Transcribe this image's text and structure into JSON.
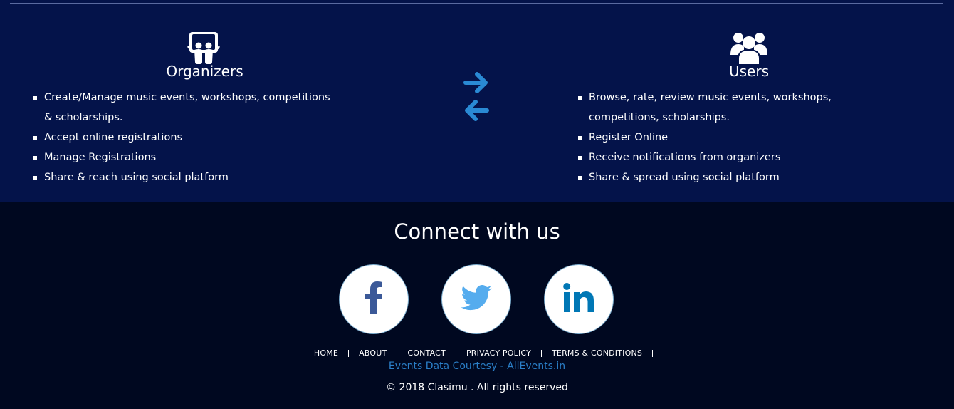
{
  "organizers": {
    "title": "Organizers",
    "icon": "slideshare-icon",
    "items": [
      "Create/Manage music events, workshops, competitions & scholarships.",
      "Accept online registrations",
      "Manage Registrations",
      "Share & reach using social platform"
    ]
  },
  "users": {
    "title": "Users",
    "icon": "users-group-icon",
    "items": [
      "Browse, rate, review music events, workshops, competitions, scholarships.",
      "Register Online",
      "Receive notifications from organizers",
      "Share & spread using social platform"
    ]
  },
  "exchange_icon": "exchange-arrows-icon",
  "connect": {
    "title": "Connect with us",
    "networks": [
      {
        "name": "facebook",
        "icon": "facebook-icon",
        "color": "#3b5998"
      },
      {
        "name": "twitter",
        "icon": "twitter-icon",
        "color": "#55acee"
      },
      {
        "name": "linkedin",
        "icon": "linkedin-icon",
        "color": "#0077b5"
      }
    ]
  },
  "footer": {
    "nav": [
      "HOME",
      "ABOUT",
      "CONTACT",
      "PRIVACY POLICY",
      "TERMS & CONDITIONS"
    ],
    "courtesy": "Events Data Courtesy - AllEvents.in",
    "copyright": "© 2018 Clasimu . All rights reserved"
  },
  "colors": {
    "top_background": "#04134a",
    "footer_background": "#000820",
    "accent_blue": "#2a8ad4",
    "link_blue": "#2a7fc8"
  }
}
